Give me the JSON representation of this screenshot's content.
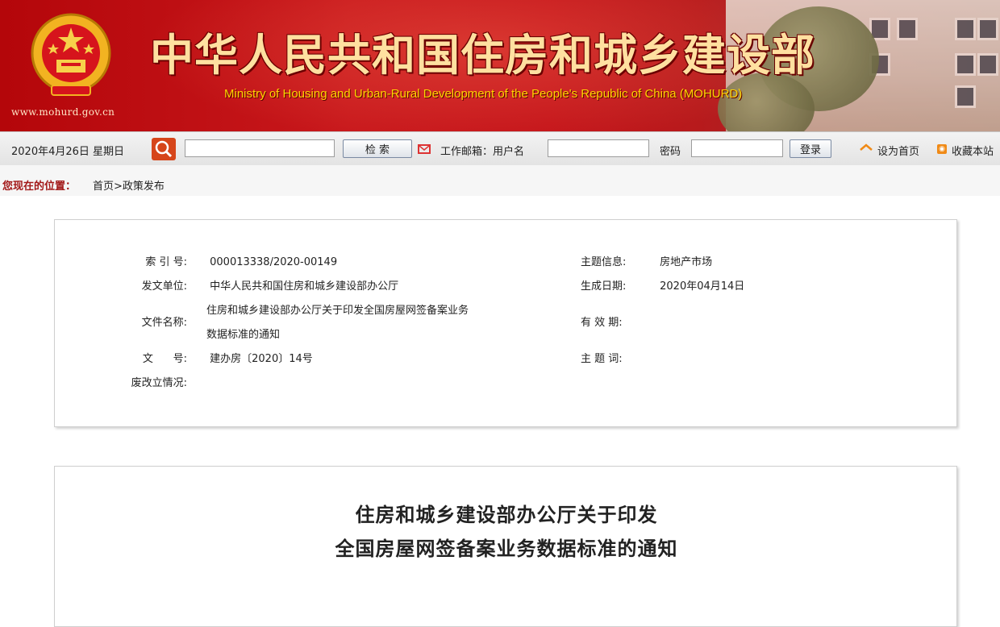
{
  "banner": {
    "site_url": "www.mohurd.gov.cn",
    "title": "中华人民共和国住房和城乡建设部",
    "subtitle": "Ministry of Housing and Urban-Rural Development of the People's Republic of China (MOHURD)"
  },
  "toolbar": {
    "date": "2020年4月26日 星期日",
    "search_button": "检 索",
    "mail_label": "工作邮箱：用户名",
    "password_label": "密码",
    "login_button": "登录",
    "set_home": "设为首页",
    "bookmark": "收藏本站"
  },
  "breadcrumb": {
    "you_are_here": "您现在的位置：",
    "path": "首页>政策发布"
  },
  "info": {
    "index_label": "索 引 号:",
    "index_value": "000013338/2020-00149",
    "theme_label": "主题信息:",
    "theme_value": "房地产市场",
    "issuer_label": "发文单位:",
    "issuer_value": "中华人民共和国住房和城乡建设部办公厅",
    "date_label": "生成日期:",
    "date_value": "2020年04月14日",
    "filename_label": "文件名称:",
    "filename_line1": "住房和城乡建设部办公厅关于印发全国房屋网签备案业务",
    "filename_line2": "数据标准的通知",
    "valid_label": "有 效 期:",
    "docno_label": "文      号:",
    "docno_value": "建办房〔2020〕14号",
    "keywords_label": "主 题 词:",
    "status_label": "废改立情况:"
  },
  "document": {
    "title_line1": "住房和城乡建设部办公厅关于印发",
    "title_line2": "全国房屋网签备案业务数据标准的通知"
  },
  "colors": {
    "banner_red": "#c4141a",
    "title_gold": "#ffe0a0",
    "subtitle_yellow": "#ffd400",
    "breadcrumb_red": "#a21818"
  }
}
